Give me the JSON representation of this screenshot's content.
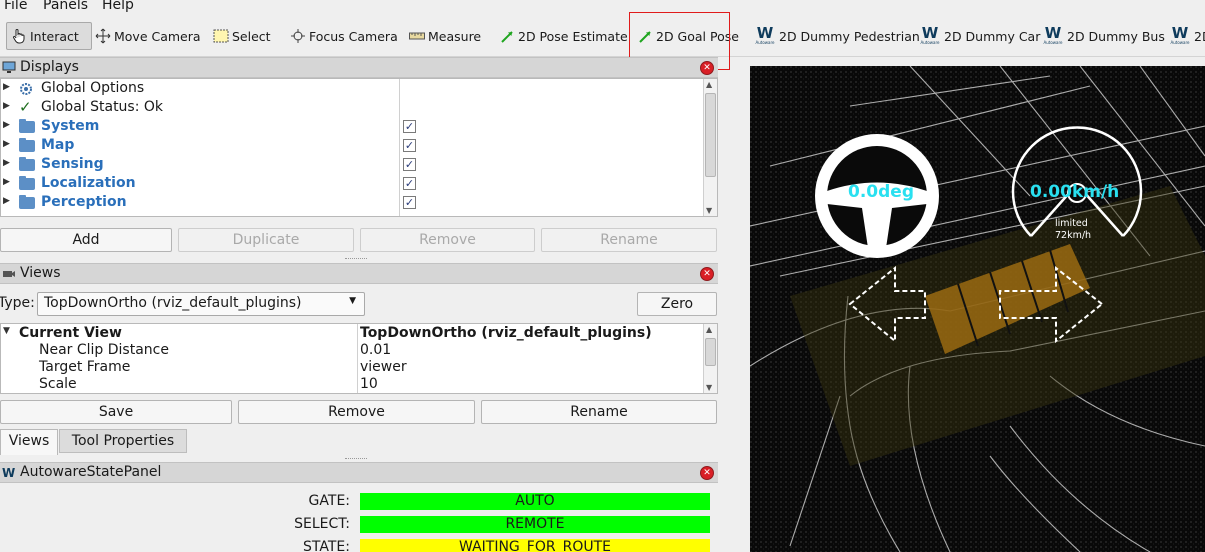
{
  "menu": {
    "file": "File",
    "panels": "Panels",
    "help": "Help"
  },
  "toolbar": {
    "interact": "Interact",
    "move_camera": "Move Camera",
    "select": "Select",
    "focus_camera": "Focus Camera",
    "measure": "Measure",
    "pose_estimate": "2D Pose Estimate",
    "goal_pose": "2D Goal Pose",
    "dummy_pedestrian": "2D Dummy Pedestrian",
    "dummy_car": "2D Dummy Car",
    "dummy_bus": "2D Dummy Bus",
    "cut_off": "2D"
  },
  "displays": {
    "title": "Displays",
    "items": [
      {
        "label": "Global Options"
      },
      {
        "label": "Global Status: Ok"
      },
      {
        "label": "System",
        "checked": true
      },
      {
        "label": "Map",
        "checked": true
      },
      {
        "label": "Sensing",
        "checked": true
      },
      {
        "label": "Localization",
        "checked": true
      },
      {
        "label": "Perception",
        "checked": true
      }
    ],
    "buttons": {
      "add": "Add",
      "duplicate": "Duplicate",
      "remove": "Remove",
      "rename": "Rename"
    }
  },
  "views": {
    "title": "Views",
    "type_label": "Type:",
    "type_value": "TopDownOrtho (rviz_default_plugins)",
    "zero": "Zero",
    "current_view": {
      "label": "Current View",
      "value": "TopDownOrtho (rviz_default_plugins)"
    },
    "properties": [
      {
        "name": "Near Clip Distance",
        "value": "0.01"
      },
      {
        "name": "Target Frame",
        "value": "viewer"
      },
      {
        "name": "Scale",
        "value": "10"
      }
    ],
    "buttons": {
      "save": "Save",
      "remove": "Remove",
      "rename": "Rename"
    },
    "tabs": [
      "Views",
      "Tool Properties"
    ]
  },
  "autoware_panel": {
    "title": "AutowareStatePanel",
    "rows": [
      {
        "label": "GATE:",
        "value": "AUTO",
        "color": "#00ff00"
      },
      {
        "label": "SELECT:",
        "value": "REMOTE",
        "color": "#00ff00"
      },
      {
        "label": "STATE:",
        "value": "WAITING_FOR_ROUTE",
        "color": "#ffff00"
      }
    ]
  },
  "viewport": {
    "steering": "0.0deg",
    "speed": "0.00km/h",
    "limit_line1": "limited",
    "limit_line2": "72km/h",
    "accent": "#29e0f0"
  }
}
